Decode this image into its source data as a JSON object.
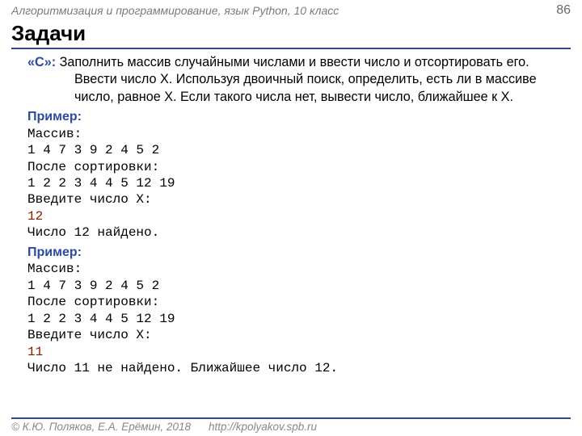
{
  "header": {
    "subject": "Алгоритмизация и программирование, язык Python, 10 класс",
    "page_number": "86"
  },
  "title": "Задачи",
  "task": {
    "label": "«C»:",
    "text_line1": "«C»: Заполнить массив случайными числами и ввести число и",
    "text_line2": "отсортировать его.  Ввести число X. Используя двоичный",
    "text_line3": "поиск, определить, есть ли в массиве число, равное X.",
    "text_line4": "Если такого числа нет, вывести число, ближайшее к X."
  },
  "example1": {
    "label": "Пример:",
    "l1": "Массив:",
    "l2": "1 4 7 3 9 2 4 5 2",
    "l3": "После сортировки:",
    "l4": "1 2 2 3 4 4 5 12 19",
    "l5": "Введите число X:",
    "l6": "12",
    "l7": "Число 12 найдено."
  },
  "example2": {
    "label": "Пример:",
    "l1": "Массив:",
    "l2": "1 4 7 3 9 2 4 5 2",
    "l3": "После сортировки:",
    "l4": "1 2 2 3 4 4 5 12 19",
    "l5": "Введите число X:",
    "l6": "11",
    "l7": "Число 11 не найдено. Ближайшее число 12."
  },
  "footer": {
    "copyright": "© К.Ю. Поляков, Е.А. Ерёмин, 2018",
    "url": "http://kpolyakov.spb.ru"
  }
}
